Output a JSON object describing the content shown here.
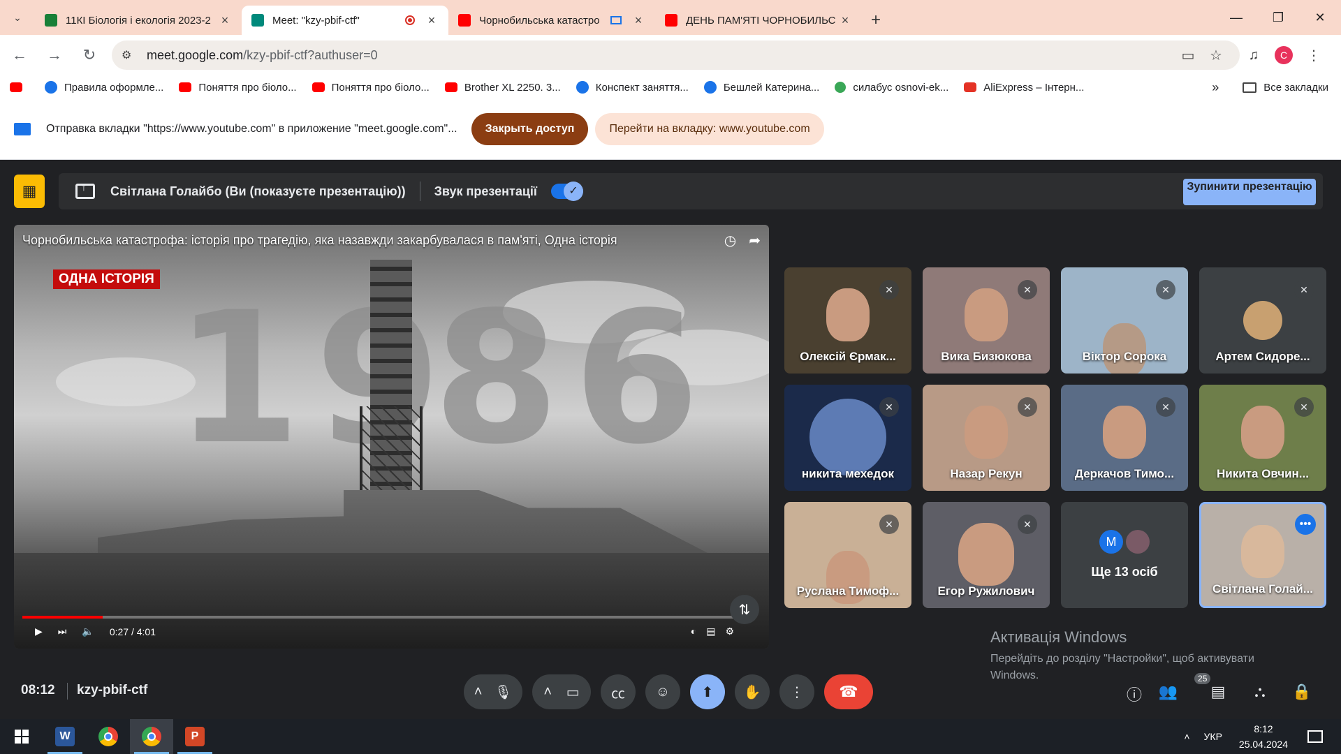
{
  "browser": {
    "tabs": [
      {
        "title": "11КІ Біологія і екологія 2023-2",
        "favicon": "#188038",
        "icon": "classroom-icon"
      },
      {
        "title": "Meet: \"kzy-pbif-ctf\"",
        "favicon": "#00897b",
        "icon": "meet-icon",
        "active": true
      },
      {
        "title": "Чорнобильська катастро",
        "favicon": "#ff0000",
        "icon": "youtube-icon"
      },
      {
        "title": "ДЕНЬ ПАМ'ЯТІ ЧОРНОБИЛЬС",
        "favicon": "#ff0000",
        "icon": "youtube-icon"
      }
    ],
    "new_tab": "+",
    "url_host": "meet.google.com",
    "url_path": "/kzy-pbif-ctf?authuser=0",
    "profile_initial": "C",
    "bookmarks": [
      {
        "label": "",
        "type": "yt"
      },
      {
        "label": "Правила оформле...",
        "type": "bl"
      },
      {
        "label": "Поняття про біоло...",
        "type": "yt"
      },
      {
        "label": "Поняття про біоло...",
        "type": "yt"
      },
      {
        "label": "Brother XL 2250. 3...",
        "type": "yt"
      },
      {
        "label": "Конспект заняття...",
        "type": "bl"
      },
      {
        "label": "Бешлей Катерина...",
        "type": "bl"
      },
      {
        "label": "силабус osnovi-ek...",
        "type": "gr"
      },
      {
        "label": "AliExpress – Інтерн...",
        "type": "ali"
      }
    ],
    "all_bookmarks": "Все закладки",
    "infobar": {
      "message": "Отправка вкладки \"https://www.youtube.com\" в приложение \"meet.google.com\"...",
      "close_access": "Закрыть доступ",
      "go_to_tab": "Перейти на вкладку: www.youtube.com"
    }
  },
  "meet": {
    "presenting_label": "Світлана Голайбо (Ви (показуєте презентацію))",
    "audio_label": "Звук презентації",
    "stop_presenting": "Зупинити презентацію",
    "video": {
      "title": "Чорнобильська катастрофа: історія про трагедію, яка назавжди закарбувалася в пам'яті, Одна історія",
      "tag": "ОДНА ІСТОРІЯ",
      "year_left": "19",
      "year_right": "86",
      "time": "0:27 / 4:01",
      "progress_fraction": 0.112
    },
    "participants": [
      {
        "name": "Олексій Єрмак...",
        "bg": "#4a4030",
        "muted": true
      },
      {
        "name": "Вика Бизюкова",
        "bg": "#8f7a78",
        "muted": true
      },
      {
        "name": "Віктор Сорока",
        "bg": "#9db4c8",
        "muted": true
      },
      {
        "name": "Артем Сидоре...",
        "bg": "#3c4043",
        "muted": true
      },
      {
        "name": "никита мехедок",
        "bg": "#1b2a4a",
        "muted": true
      },
      {
        "name": "Назар Рекун",
        "bg": "#b89a86",
        "muted": true
      },
      {
        "name": "Деркачов Тимо...",
        "bg": "#5a6c86",
        "muted": true
      },
      {
        "name": "Никита Овчин...",
        "bg": "#6e7e4a",
        "muted": true
      },
      {
        "name": "Руслана Тимоф...",
        "bg": "#c9b096",
        "muted": true
      },
      {
        "name": "Егор Ружилович",
        "bg": "#5e5e66",
        "muted": true
      }
    ],
    "others": {
      "label": "Ще 13 осіб",
      "avatar_letter": "M"
    },
    "self_tile": {
      "name": "Світлана Голай...",
      "bg": "#b9b0a8"
    },
    "watermark": {
      "title": "Активація Windows",
      "subtitle": "Перейдіть до розділу \"Настройки\", щоб активувати Windows."
    },
    "clock": "08:12",
    "meeting_code": "kzy-pbif-ctf",
    "participant_count": "25"
  },
  "taskbar": {
    "lang": "УКР",
    "time": "8:12",
    "date": "25.04.2024"
  },
  "colors": {
    "tabstrip": "#f9d9cc",
    "meet_bg": "#202124",
    "accent": "#8ab4f8",
    "end_call": "#ea4335"
  }
}
